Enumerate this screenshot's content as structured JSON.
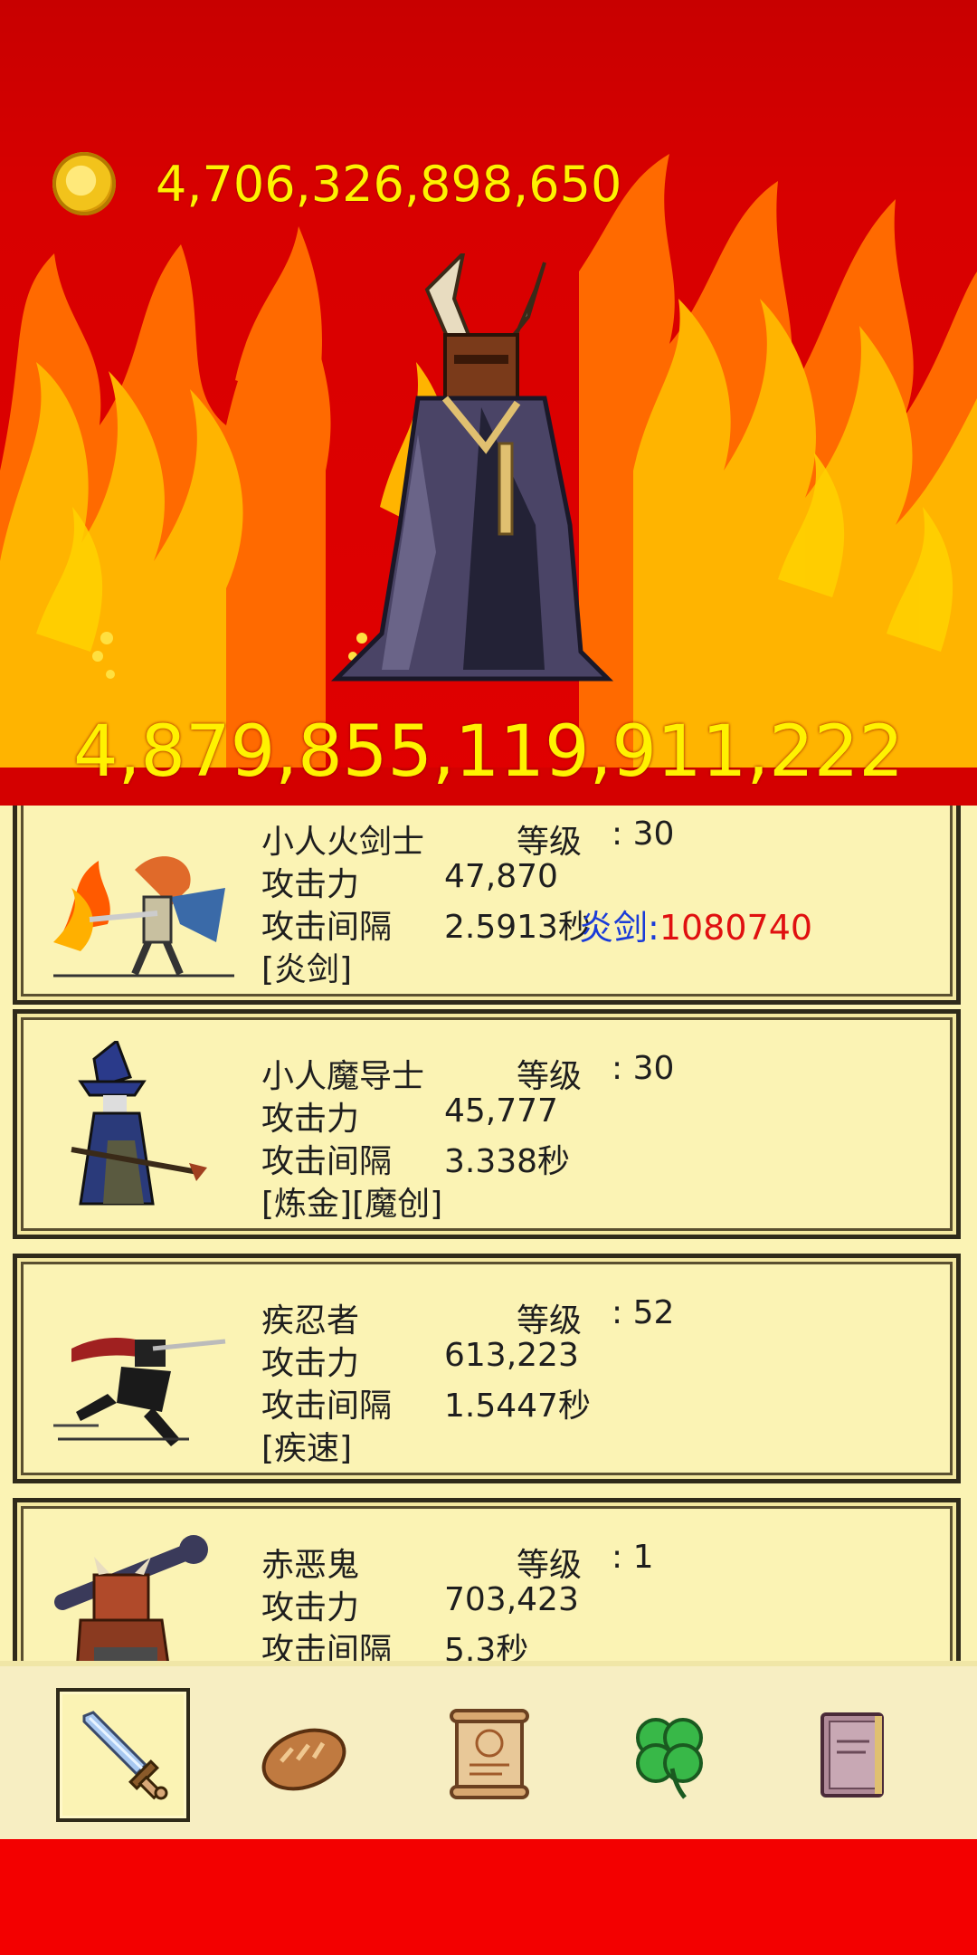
{
  "hud": {
    "gold": "4,706,326,898,650",
    "gold_icon": "coin-icon",
    "boss_hp": "4,879,855,119,911,222"
  },
  "heroes": [
    {
      "name": "小人火剑士",
      "level_label": "等级",
      "level": ": 30",
      "attack_label": "攻击力",
      "attack": "47,870",
      "interval_label": "攻击间隔",
      "interval": "2.5913秒",
      "skills": "[炎剑]"
    },
    {
      "name": "小人魔导士",
      "level_label": "等级",
      "level": ": 30",
      "attack_label": "攻击力",
      "attack": "45,777",
      "interval_label": "攻击间隔",
      "interval": "3.338秒",
      "skills": "[炼金][魔创]"
    },
    {
      "name": "疾忍者",
      "level_label": "等级",
      "level": ": 52",
      "attack_label": "攻击力",
      "attack": "613,223",
      "interval_label": "攻击间隔",
      "interval": "1.5447秒",
      "skills": "[疾速]"
    },
    {
      "name": "赤恶鬼",
      "level_label": "等级",
      "level": ": 1",
      "attack_label": "攻击力",
      "attack": "703,423",
      "interval_label": "攻击间隔",
      "interval": "5.3秒",
      "skills": ""
    }
  ],
  "skill_proc": {
    "label": "炎剑:",
    "value": "1080740"
  },
  "nav": [
    {
      "icon": "sword-icon",
      "active": true
    },
    {
      "icon": "bread-icon",
      "active": false
    },
    {
      "icon": "scroll-icon",
      "active": false
    },
    {
      "icon": "clover-icon",
      "active": false
    },
    {
      "icon": "book-icon",
      "active": false
    }
  ],
  "colors": {
    "hud_text": "#fff200",
    "scene_red": "#e00000",
    "panel": "#fbf3b4",
    "proc_label": "#1a3bd8",
    "proc_value": "#e01010"
  }
}
